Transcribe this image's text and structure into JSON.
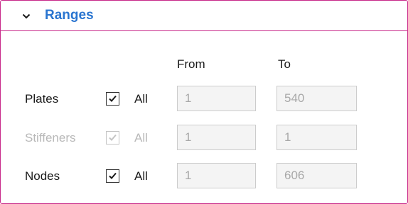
{
  "section": {
    "title": "Ranges",
    "expanded": true
  },
  "columns": {
    "from": "From",
    "to": "To"
  },
  "rows": [
    {
      "label": "Plates",
      "all_label": "All",
      "all_checked": true,
      "enabled": true,
      "from": "1",
      "to": "540"
    },
    {
      "label": "Stiffeners",
      "all_label": "All",
      "all_checked": true,
      "enabled": false,
      "from": "1",
      "to": "1"
    },
    {
      "label": "Nodes",
      "all_label": "All",
      "all_checked": true,
      "enabled": true,
      "from": "1",
      "to": "606"
    }
  ],
  "colors": {
    "accent_border": "#c8298a",
    "title_blue": "#2a75d0"
  },
  "icons": {
    "collapse": "chevron-down-icon",
    "check": "checkmark-icon"
  }
}
